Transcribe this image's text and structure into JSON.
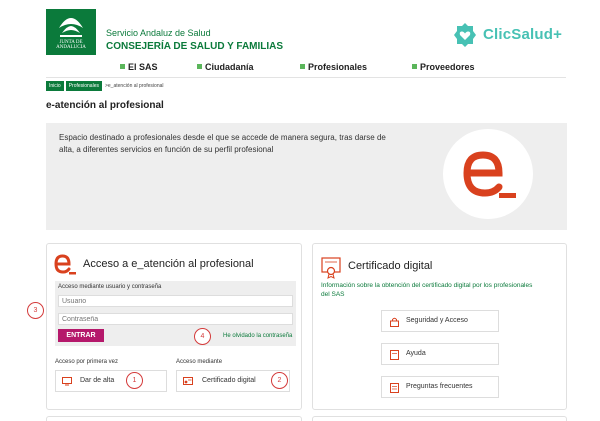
{
  "header": {
    "logo_caption": "JUNTA DE ANDALUCIA",
    "org_line1": "Servicio Andaluz de Salud",
    "org_line2": "CONSEJERÍA DE SALUD Y FAMILIAS",
    "brand": "ClicSalud+",
    "brand_color": "#47c1b4",
    "accent_color": "#0b7a3b"
  },
  "nav": {
    "items": [
      {
        "label": "El SAS"
      },
      {
        "label": "Ciudadanía"
      },
      {
        "label": "Profesionales"
      },
      {
        "label": "Proveedores"
      }
    ]
  },
  "breadcrumb": {
    "items": [
      "Inicio",
      "Profesionales"
    ],
    "current": ">e_atención al profesional"
  },
  "page": {
    "title": "e-atención al profesional",
    "intro": "Espacio destinado a profesionales desde el que se accede de manera segura, tras darse de alta, a diferentes servicios en función de su perfil profesional"
  },
  "access_card": {
    "title": "Acceso a e_atención al profesional",
    "login_label": "Acceso mediante usuario y contraseña",
    "user_placeholder": "Usuario",
    "pass_placeholder": "Contraseña",
    "submit_label": "ENTRAR",
    "submit_color": "#b5186b",
    "forgot_label": "He olvidado la contraseña",
    "first_time_label": "Acceso por primera vez",
    "via_label": "Acceso mediante",
    "signup_label": "Dar de alta",
    "cert_label": "Certificado digital"
  },
  "cert_card": {
    "title": "Certificado digital",
    "description": "Información sobre la obtención del certificado digital por los profesionales del SAS",
    "buttons": [
      {
        "label": "Seguridad y Acceso",
        "icon": "padlock-icon"
      },
      {
        "label": "Ayuda",
        "icon": "document-icon"
      },
      {
        "label": "Preguntas frecuentes",
        "icon": "document-icon"
      }
    ]
  },
  "annotations": [
    "1",
    "2",
    "3",
    "4"
  ]
}
